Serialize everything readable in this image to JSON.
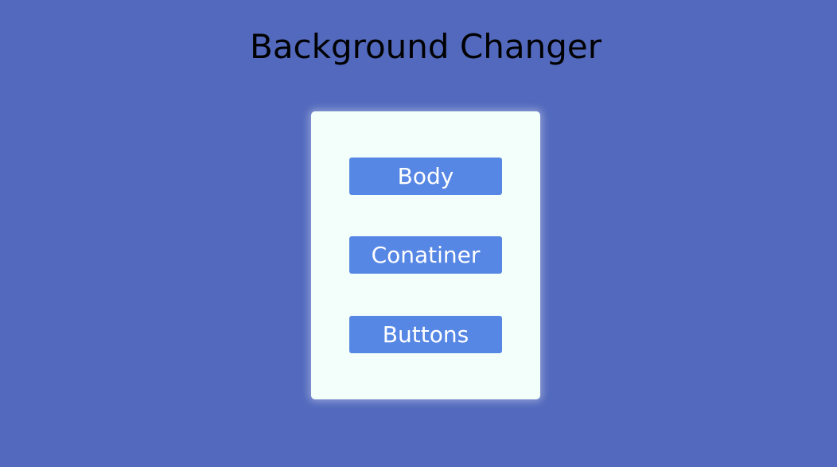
{
  "title": "Background Changer",
  "buttons": [
    {
      "label": "Body"
    },
    {
      "label": "Conatiner"
    },
    {
      "label": "Buttons"
    }
  ],
  "colors": {
    "body_background": "#5269bd",
    "card_background": "#f3fffb",
    "button_background": "#5787e4",
    "button_text": "#ffffff",
    "title_text": "#000000"
  }
}
